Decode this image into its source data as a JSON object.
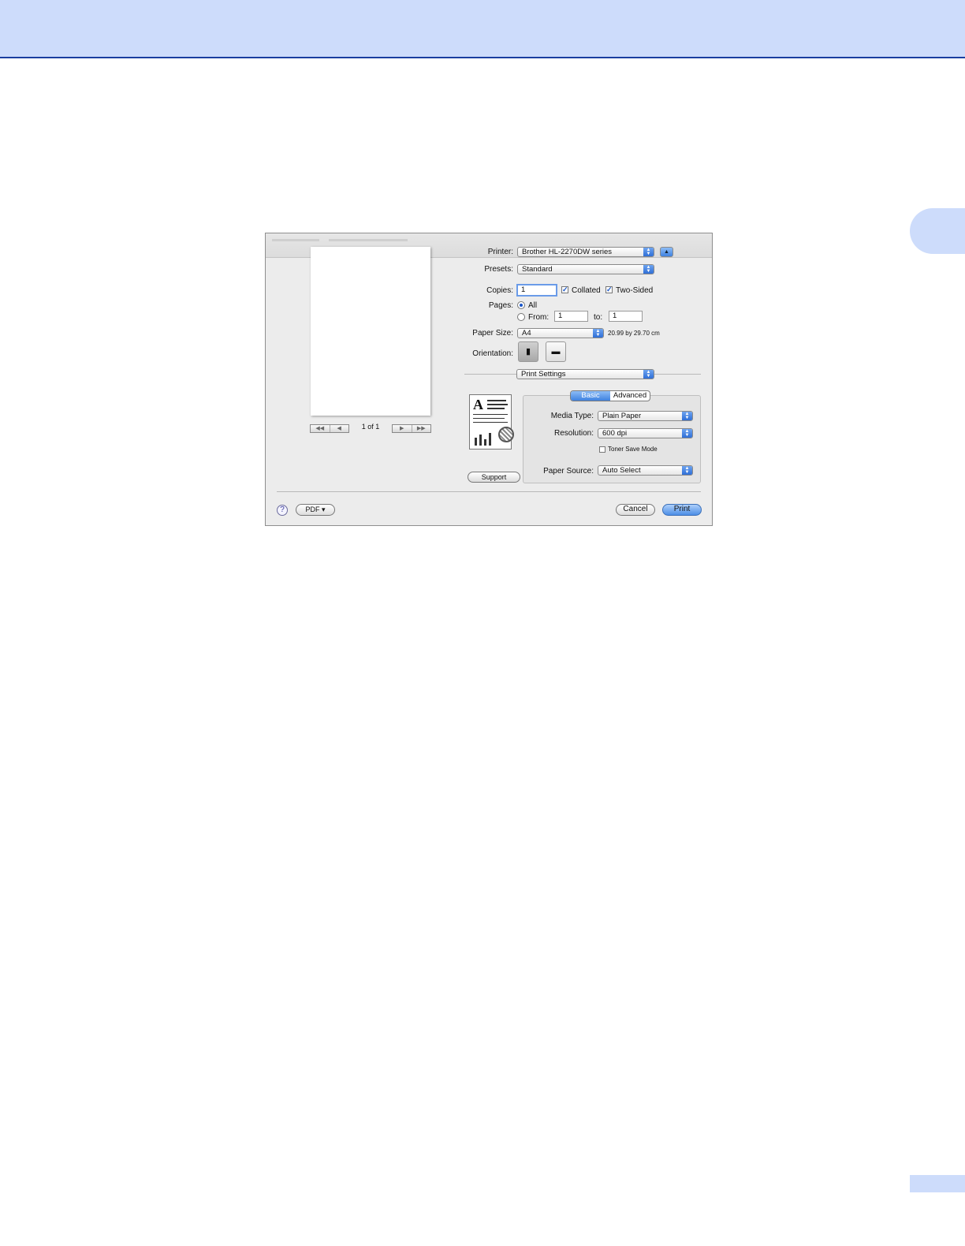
{
  "dialog": {
    "preview": {
      "page_count": "1 of 1",
      "nav_first": "◀◀",
      "nav_prev": "◀",
      "nav_next": "▶",
      "nav_last": "▶▶"
    },
    "printer": {
      "label": "Printer:",
      "value": "Brother HL-2270DW series",
      "disclosure_icon": "▲"
    },
    "presets": {
      "label": "Presets:",
      "value": "Standard"
    },
    "copies": {
      "label": "Copies:",
      "value": "1",
      "collated_label": "Collated",
      "collated_checked": true,
      "two_sided_label": "Two-Sided",
      "two_sided_checked": true
    },
    "pages": {
      "label": "Pages:",
      "all_label": "All",
      "from_label": "From:",
      "from_value": "1",
      "to_label": "to:",
      "to_value": "1"
    },
    "paper_size": {
      "label": "Paper Size:",
      "value": "A4",
      "dimensions": "20.99 by 29.70 cm"
    },
    "orientation": {
      "label": "Orientation:",
      "portrait_icon": "portrait-icon",
      "landscape_icon": "landscape-icon"
    },
    "section_popup": {
      "value": "Print Settings"
    },
    "tabs": [
      {
        "label": "Basic",
        "active": true
      },
      {
        "label": "Advanced",
        "active": false
      }
    ],
    "media_type": {
      "label": "Media Type:",
      "value": "Plain Paper"
    },
    "resolution": {
      "label": "Resolution:",
      "value": "600 dpi"
    },
    "toner_save": {
      "label": "Toner Save Mode",
      "checked": false
    },
    "paper_source": {
      "label": "Paper Source:",
      "value": "Auto Select"
    },
    "support_button": "Support",
    "help_icon": "?",
    "pdf_button": "PDF ▾",
    "cancel_button": "Cancel",
    "print_button": "Print",
    "colors": {
      "accent": "#3f82e0",
      "page_band": "#cddcfb",
      "band_rule": "#1a3fa0"
    }
  }
}
